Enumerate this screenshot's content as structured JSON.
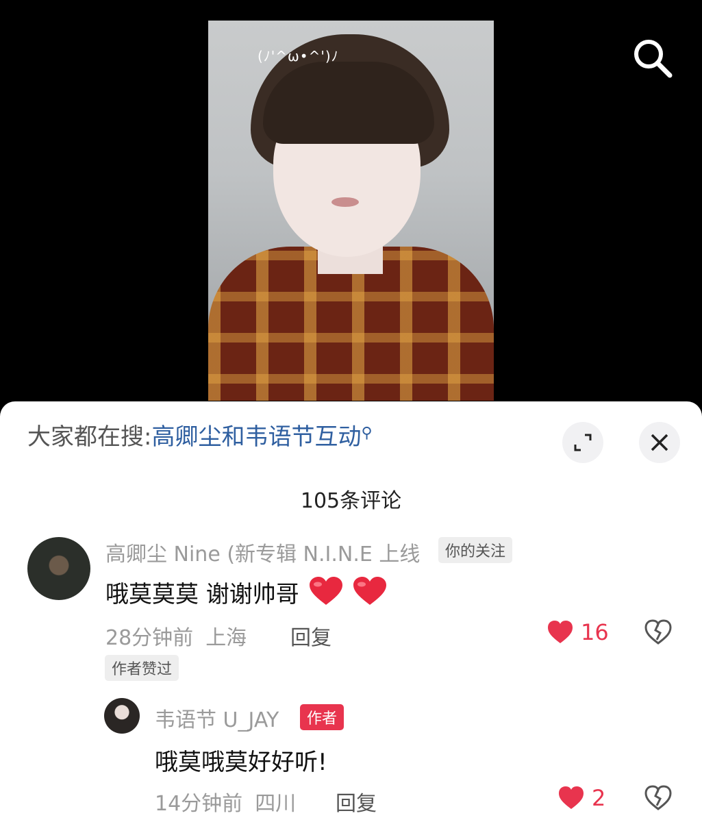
{
  "video": {
    "overlay_text": "(ﾉ'^ω•^')ﾉ"
  },
  "header": {
    "search_prefix": "大家都在搜:",
    "search_link": "高卿尘和韦语节互动"
  },
  "comments_count_label": "105条评论",
  "comments": [
    {
      "username": "高卿尘 Nine (新专辑 N.I.N.E 上线",
      "badge": "你的关注",
      "text": "哦莫莫莫 谢谢帅哥",
      "time": "28分钟前",
      "location": "上海",
      "reply_label": "回复",
      "likes": "16",
      "author_liked_label": "作者赞过"
    },
    {
      "username": "韦语节 U_JAY",
      "badge": "作者",
      "text": "哦莫哦莫好好听!",
      "time": "14分钟前",
      "location": "四川",
      "reply_label": "回复",
      "likes": "2"
    }
  ],
  "colors": {
    "accent_red": "#e8344e",
    "link_blue": "#2f5fa0"
  },
  "icons": [
    "search-icon",
    "expand-icon",
    "close-icon",
    "heart-icon",
    "broken-heart-icon",
    "search-small-icon"
  ]
}
